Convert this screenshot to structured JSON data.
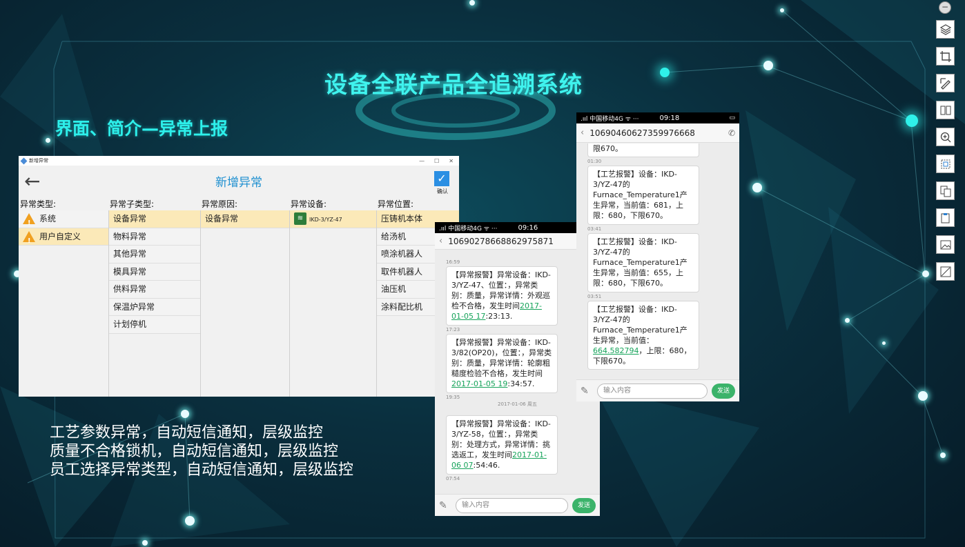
{
  "main_title": "设备全联产品全追溯系统",
  "sub_title": "界面、简介—异常上报",
  "desc_lines": [
    "工艺参数异常，自动短信通知，层级监控",
    "质量不合格锁机，自动短信通知，层级监控",
    "员工选择异常类型，自动短信通知，层级监控"
  ],
  "window": {
    "bar_title": "新增异常",
    "controls": [
      "—",
      "☐",
      "✕"
    ],
    "back": "←",
    "title": "新增异常",
    "confirm_check": "✓",
    "confirm_label": "确认",
    "columns": {
      "type": {
        "header": "异常类型:",
        "items": [
          "系统",
          "用户自定义"
        ]
      },
      "subtype": {
        "header": "异常子类型:",
        "items": [
          "设备异常",
          "物料异常",
          "其他异常",
          "模具异常",
          "供料异常",
          "保温炉异常",
          "计划停机"
        ]
      },
      "reason": {
        "header": "异常原因:",
        "items": [
          "设备异常"
        ]
      },
      "device": {
        "header": "异常设备:",
        "items": [
          "IKD-3/YZ-47"
        ]
      },
      "location": {
        "header": "异常位置:",
        "items": [
          "压铸机本体",
          "给汤机",
          "喷涂机器人",
          "取件机器人",
          "油压机",
          "涂料配比机"
        ]
      }
    }
  },
  "phone1": {
    "carrier": ".ııl 中国移动4G ᯤ ···",
    "time": "09:16",
    "number": "10690278668862975871",
    "messages": [
      {
        "ts": "16:59",
        "pre": "【异常报警】异常设备：IKD-3/YZ-47、位置：，异常类别：质量，异常详情：外观巡检不合格，发生时间",
        "link": "2017-01-05 17",
        "post": ":23:13."
      },
      {
        "ts": "17:23",
        "pre": "【异常报警】异常设备：IKD-3/82(OP20)，位置：，异常类别：质量，异常详情：轮廓粗糙度检验不合格，发生时间",
        "link": "2017-01-05 19",
        "post": ":34:57."
      },
      {
        "ts": "19:35",
        "pre": "【异常报警】异常设备：IKD-3/YZ-58，位置：，异常类别：处理方式，异常详情：挑选返工，发生时间",
        "link": "2017-01-06 07",
        "post": ":54:46."
      }
    ],
    "date_sep": "2017-01-06 周五",
    "end_ts": "07:54",
    "input_placeholder": "输入内容",
    "send": "发送"
  },
  "phone2": {
    "carrier": ".ııl 中国移动4G ᯤ ···",
    "time": "09:18",
    "number": "10690460627359976668",
    "top_text": "限670。",
    "messages": [
      {
        "ts": "01:30",
        "pre": "【工艺报警】设备：IKD-3/YZ-47的Furnace_Temperature1产生异常，当前值：681，上限：680，下限670。",
        "link": "",
        "post": ""
      },
      {
        "ts": "03:41",
        "pre": "【工艺报警】设备：IKD-3/YZ-47的Furnace_Temperature1产生异常，当前值：655，上限：680，下限670。",
        "link": "",
        "post": ""
      },
      {
        "ts": "03:51",
        "pre": "【工艺报警】设备：IKD-3/YZ-47的Furnace_Temperature1产生异常，当前值：",
        "link": "664.582794",
        "post": "，上限：680，下限670。"
      }
    ],
    "input_placeholder": "输入内容",
    "send": "发送"
  },
  "toolbar": {
    "icons": [
      "minimize-icon",
      "layers-icon",
      "crop-icon",
      "pen-icon",
      "compare-icon",
      "zoom-in-icon",
      "fit-icon",
      "copy-icon",
      "paste-icon",
      "image-icon",
      "slash-icon"
    ]
  },
  "colors": {
    "accent": "#2df0eb",
    "window_blue": "#1d8fd0",
    "send_green": "#3bb36a",
    "link_green": "#16a35a"
  }
}
